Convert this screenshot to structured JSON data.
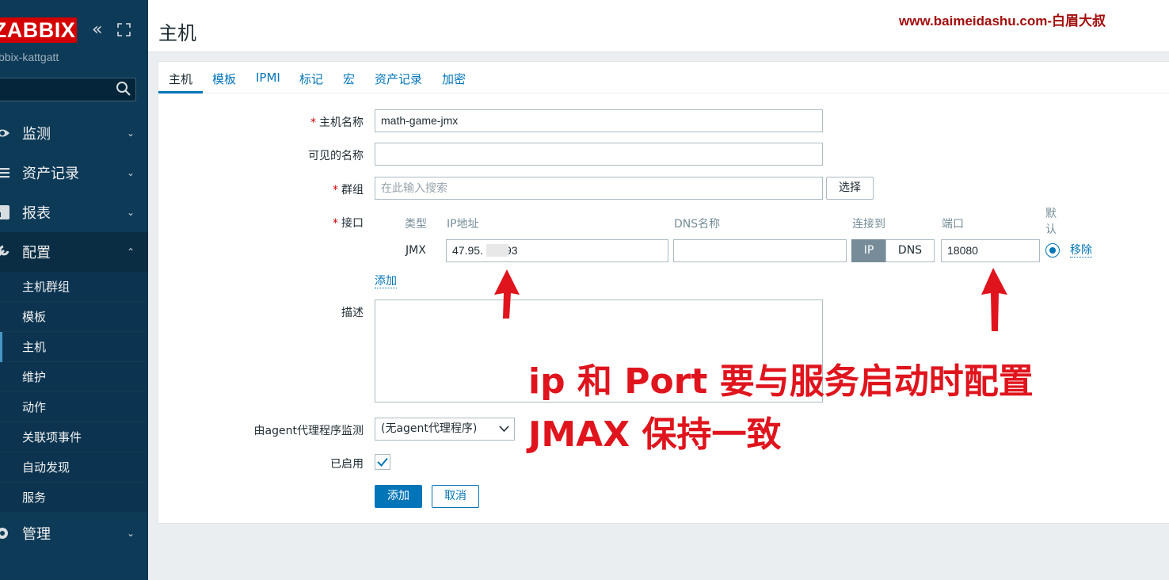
{
  "sidebar": {
    "logo": "ZABBIX",
    "server_name": "bbix-kattgatt",
    "collapse_symbol": "«",
    "menu": [
      {
        "label": "监测",
        "icon": "eye-icon",
        "chevron": "⌄"
      },
      {
        "label": "资产记录",
        "icon": "list-icon",
        "chevron": "⌄"
      },
      {
        "label": "报表",
        "icon": "report-icon",
        "chevron": "⌄"
      },
      {
        "label": "配置",
        "icon": "wrench-icon",
        "chevron": "⌃"
      },
      {
        "label": "管理",
        "icon": "gear-icon",
        "chevron": "⌄"
      }
    ],
    "submenu": [
      "主机群组",
      "模板",
      "主机",
      "维护",
      "动作",
      "关联项事件",
      "自动发现",
      "服务"
    ]
  },
  "header": {
    "title": "主机",
    "watermark": "www.baimeidashu.com-白眉大叔"
  },
  "tabs": [
    "主机",
    "模板",
    "IPMI",
    "标记",
    "宏",
    "资产记录",
    "加密"
  ],
  "form": {
    "required_mark": "*",
    "host_name_label": "主机名称",
    "host_name_value": "math-game-jmx",
    "visible_name_label": "可见的名称",
    "visible_name_value": "",
    "groups_label": "群组",
    "groups_placeholder": "在此输入搜索",
    "select_button": "选择",
    "interfaces_label": "接口",
    "interface_headers": {
      "type": "类型",
      "ip": "IP地址",
      "dns": "DNS名称",
      "connect_to": "连接到",
      "port": "端口",
      "default": "默认"
    },
    "interface": {
      "type": "JMX",
      "ip": "47.95.",
      "ip_tail": "93",
      "dns": "",
      "connect_ip": "IP",
      "connect_dns": "DNS",
      "port": "18080",
      "remove": "移除"
    },
    "add_link": "添加",
    "description_label": "描述",
    "proxy_label": "由agent代理程序监测",
    "proxy_value": "(无agent代理程序)",
    "enabled_label": "已启用",
    "enabled_checked": true,
    "add_button": "添加",
    "cancel_button": "取消"
  },
  "annotation": {
    "line1": "ip  和 Port 要与服务启动时配置",
    "line2": "JMAX 保持一致",
    "color": "#e0141d"
  }
}
